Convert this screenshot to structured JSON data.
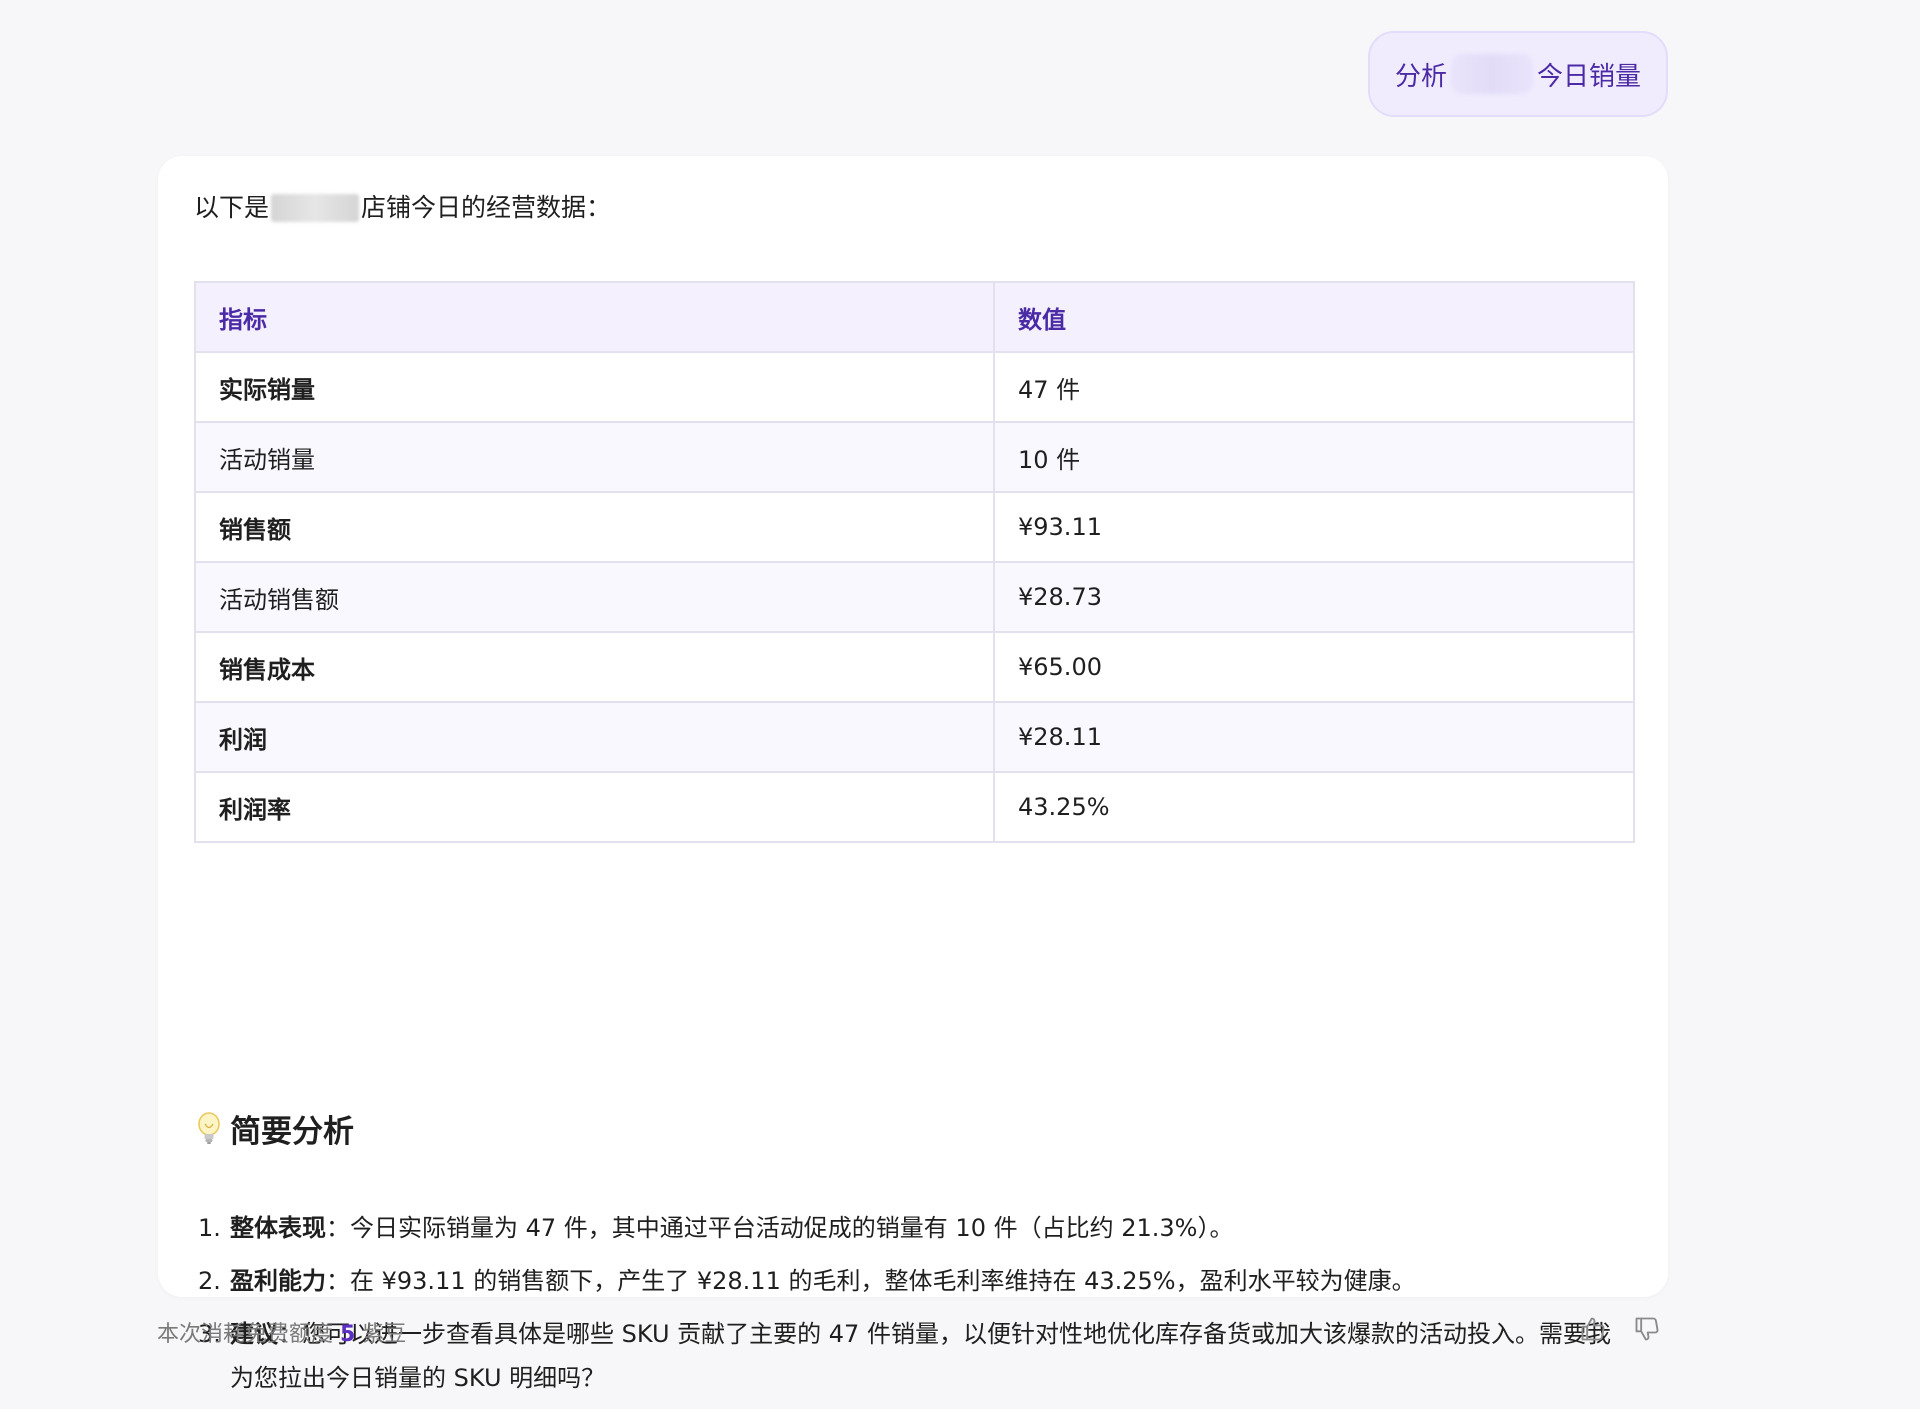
{
  "user_message": {
    "prefix": "分析",
    "suffix": "今日销量"
  },
  "answer": {
    "intro_prefix": "以下是 ",
    "intro_suffix": "店铺今日的经营数据：",
    "table": {
      "headers": [
        "指标",
        "数值"
      ],
      "rows": [
        {
          "metric": "实际销量",
          "value": "47 件",
          "bold": true
        },
        {
          "metric": "活动销量",
          "value": "10 件",
          "bold": false
        },
        {
          "metric": "销售额",
          "value": "¥93.11",
          "bold": true
        },
        {
          "metric": "活动销售额",
          "value": "¥28.73",
          "bold": false
        },
        {
          "metric": "销售成本",
          "value": "¥65.00",
          "bold": true
        },
        {
          "metric": "利润",
          "value": "¥28.11",
          "bold": true
        },
        {
          "metric": "利润率",
          "value": "43.25%",
          "bold": true
        }
      ]
    },
    "section_title": "简要分析",
    "section_icon": "lightbulb-icon",
    "analysis": [
      {
        "num": "1.",
        "title": "整体表现",
        "text": "：今日实际销量为 47 件，其中通过平台活动促成的销量有 10 件（占比约 21.3%）。"
      },
      {
        "num": "2.",
        "title": "盈利能力",
        "text": "：在 ¥93.11 的销售额下，产生了 ¥28.11 的毛利，整体毛利率维持在 43.25%，盈利水平较为健康。"
      },
      {
        "num": "3.",
        "title": "建议",
        "text": "：您可以进一步查看具体是哪些 SKU 贡献了主要的 47 件销量，以便针对性地优化库存备货或加大该爆款的活动投入。需要我为您拉出今日销量的 SKU 明细吗？"
      }
    ]
  },
  "footer": {
    "prefix": "本次消耗免费额度 ",
    "count": "5",
    "suffix": " 紫豆",
    "like_icon": "thumbs-up-icon",
    "dislike_icon": "thumbs-down-icon"
  },
  "colors": {
    "accent": "#4b2aa5",
    "bubble_bg": "#f0ecfd",
    "table_header_bg": "#f4f0fd",
    "page_bg": "#f7f7f9"
  }
}
